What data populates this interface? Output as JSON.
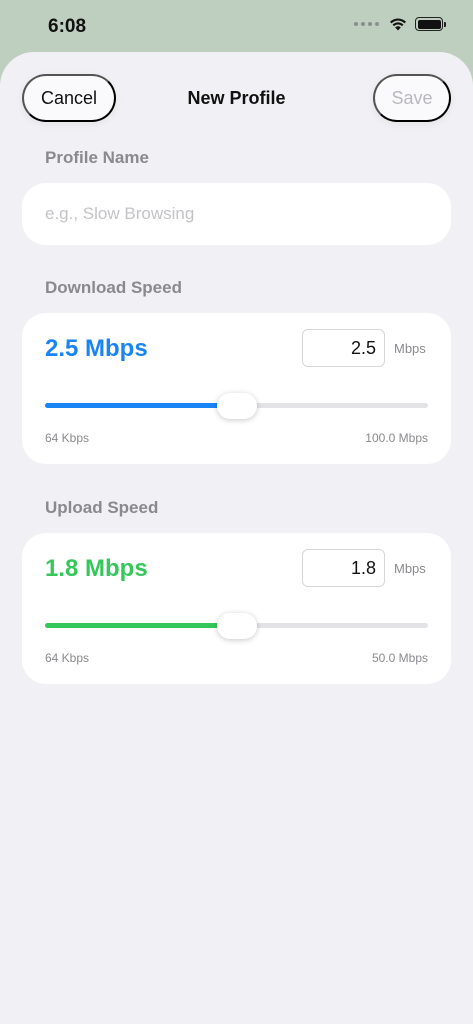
{
  "status": {
    "time": "6:08"
  },
  "nav": {
    "cancel": "Cancel",
    "title": "New Profile",
    "save": "Save"
  },
  "profile_name": {
    "label": "Profile Name",
    "placeholder": "e.g., Slow Browsing",
    "value": ""
  },
  "download": {
    "label": "Download Speed",
    "display": "2.5 Mbps",
    "input_value": "2.5",
    "unit": "Mbps",
    "min_label": "64 Kbps",
    "max_label": "100.0 Mbps",
    "slider_fraction": 0.5,
    "color": "#1a84f5"
  },
  "upload": {
    "label": "Upload Speed",
    "display": "1.8 Mbps",
    "input_value": "1.8",
    "unit": "Mbps",
    "min_label": "64 Kbps",
    "max_label": "50.0 Mbps",
    "slider_fraction": 0.5,
    "color": "#34c759"
  }
}
